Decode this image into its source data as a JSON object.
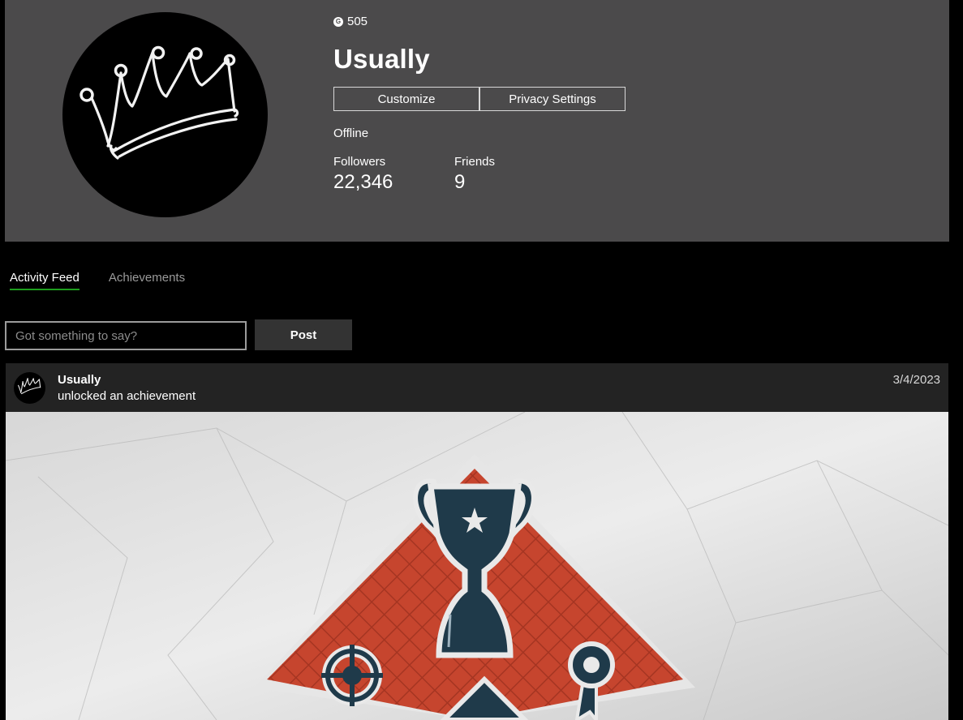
{
  "profile": {
    "gamerscore_icon": "G",
    "gamerscore": "505",
    "gamertag": "Usually",
    "customize_label": "Customize",
    "privacy_label": "Privacy Settings",
    "presence": "Offline",
    "followers_label": "Followers",
    "followers_count": "22,346",
    "friends_label": "Friends",
    "friends_count": "9",
    "avatar_icon": "crown-icon"
  },
  "tabs": [
    {
      "label": "Activity Feed",
      "active": true
    },
    {
      "label": "Achievements",
      "active": false
    }
  ],
  "composer": {
    "placeholder": "Got something to say?",
    "post_label": "Post"
  },
  "feed": [
    {
      "user": "Usually",
      "action": "unlocked an achievement",
      "date": "3/4/2023",
      "image_icon": "trophy-achievement-art"
    }
  ],
  "colors": {
    "header_bg": "#4b4a4b",
    "page_bg": "#000000",
    "feed_bg": "#232323",
    "active_tab_accent": "#1e9e1e",
    "post_button_bg": "#333333"
  }
}
